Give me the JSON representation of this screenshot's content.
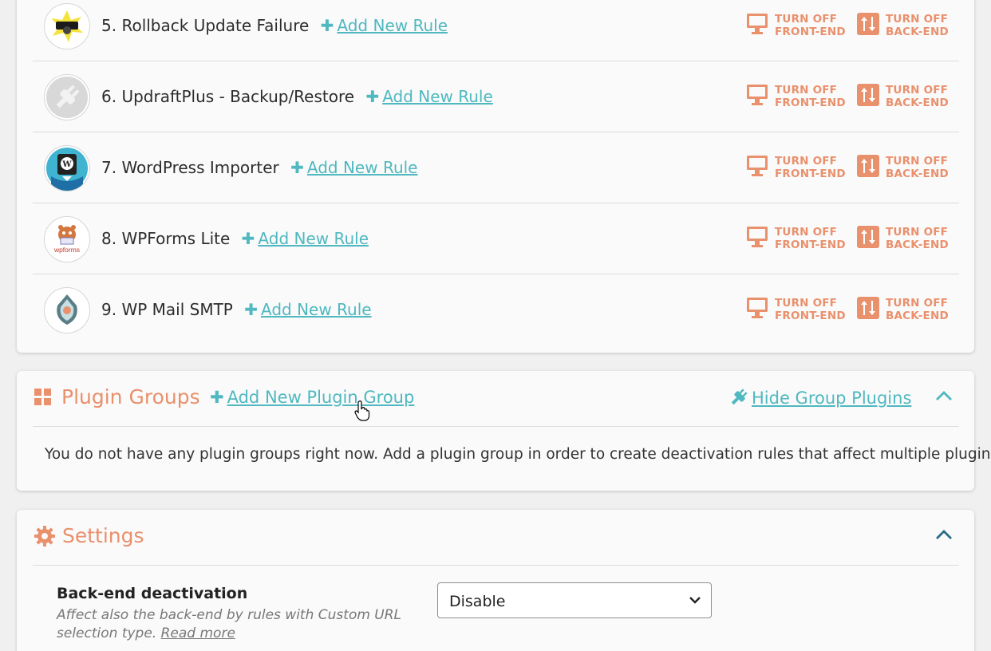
{
  "plugins": [
    {
      "number": "5.",
      "name": "Rollback Update Failure",
      "add_rule": "Add New Rule",
      "logo_icon": "rollback-logo-icon"
    },
    {
      "number": "6.",
      "name": "UpdraftPlus - Backup/Restore",
      "add_rule": "Add New Rule",
      "logo_icon": "plug-logo-icon"
    },
    {
      "number": "7.",
      "name": "WordPress Importer",
      "add_rule": "Add New Rule",
      "logo_icon": "wordpress-logo-icon"
    },
    {
      "number": "8.",
      "name": "WPForms Lite",
      "add_rule": "Add New Rule",
      "logo_icon": "wpforms-logo-icon"
    },
    {
      "number": "9.",
      "name": "WP Mail SMTP",
      "add_rule": "Add New Rule",
      "logo_icon": "wp-mail-smtp-logo-icon"
    }
  ],
  "toggles": {
    "front_line1": "TURN OFF",
    "front_line2": "FRONT-END",
    "back_line1": "TURN OFF",
    "back_line2": "BACK-END"
  },
  "wpforms_logo_text": "wpforms",
  "plugin_groups": {
    "title": "Plugin Groups",
    "add_label": "Add New Plugin Group",
    "hide_label": "Hide Group Plugins",
    "empty_message": "You do not have any plugin groups right now. Add a plugin group in order to create deactivation rules that affect multiple plugins."
  },
  "settings": {
    "title": "Settings",
    "backend_label": "Back-end deactivation",
    "backend_desc": "Affect also the back-end by rules with Custom URL selection type.",
    "read_more": "Read more",
    "backend_value": "Disable"
  },
  "colors": {
    "accent_orange": "#e9906c",
    "accent_teal": "#4fb8c0"
  }
}
